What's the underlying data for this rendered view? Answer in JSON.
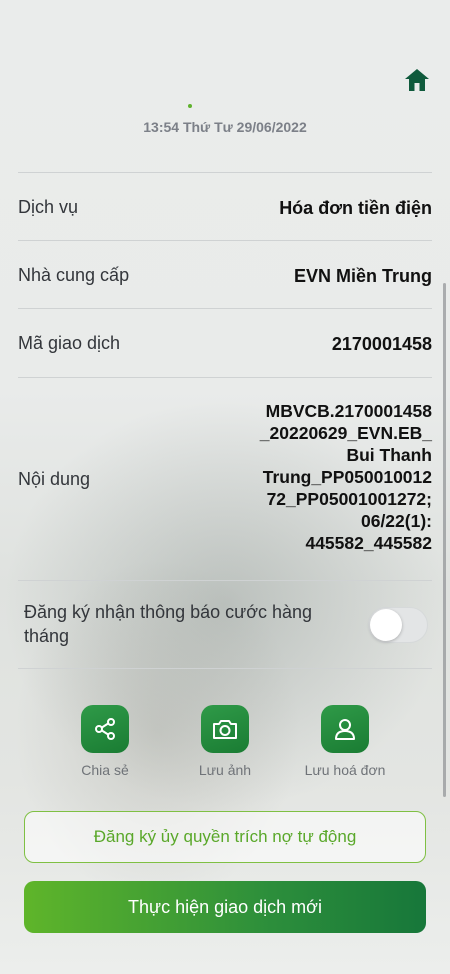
{
  "header": {
    "datetime": "13:54 Thứ Tư 29/06/2022",
    "home_icon": "home-icon"
  },
  "details": {
    "service": {
      "label": "Dịch vụ",
      "value": "Hóa đơn tiền điện"
    },
    "provider": {
      "label": "Nhà cung cấp",
      "value": "EVN Miền Trung"
    },
    "transaction_code": {
      "label": "Mã giao dịch",
      "value": "2170001458"
    },
    "content": {
      "label": "Nội dung",
      "value": "MBVCB.2170001458\n_20220629_EVN.EB_\nBui Thanh\nTrung_PP050010012\n72_PP05001001272;\n06/22(1):\n445582_445582"
    }
  },
  "notification": {
    "label": "Đăng ký nhận thông báo cước hàng tháng",
    "enabled": false
  },
  "actions": [
    {
      "label": "Chia sẻ",
      "icon": "share-icon"
    },
    {
      "label": "Lưu ảnh",
      "icon": "camera-icon"
    },
    {
      "label": "Lưu hoá đơn",
      "icon": "user-icon"
    }
  ],
  "buttons": {
    "auto_debit": "Đăng ký ủy quyền trích nợ tự động",
    "new_transaction": "Thực hiện giao dịch mới"
  },
  "colors": {
    "brand_green": "#1f8a3a",
    "accent_green": "#5fb22d"
  }
}
